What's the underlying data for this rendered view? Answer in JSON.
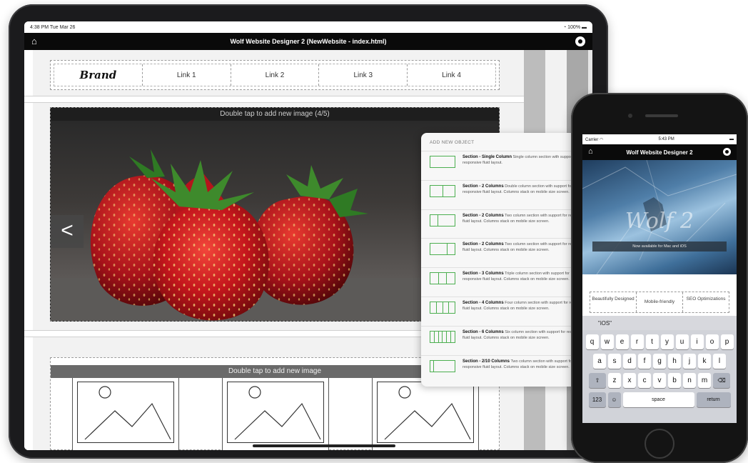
{
  "ipad": {
    "status": {
      "time": "4:38 PM  Tue Mar 26",
      "battery": "100%"
    },
    "nav": {
      "title": "Wolf Website Designer 2 (NewWebsite - index.html)",
      "home_icon": "home-icon",
      "settings_icon": "gear-icon"
    },
    "navbar": {
      "brand": "Brand",
      "links": [
        "Link 1",
        "Link 2",
        "Link 3",
        "Link 4"
      ]
    },
    "carousel": {
      "label": "Double tap to add new image (4/5)",
      "prev": "<"
    },
    "images": {
      "label": "Double tap to add new image"
    },
    "panel": {
      "title": "ADD NEW OBJECT",
      "items": [
        {
          "name": "Section - Single Column",
          "desc": "Single column section with support for responsive fluid layout."
        },
        {
          "name": "Section - 2 Columns",
          "desc": "Double column section with support for responsive fluid layout.  Columns stack on mobile size screen."
        },
        {
          "name": "Section - 2 Columns",
          "desc": "Two column section with support for responsive fluid layout.  Columns stack on mobile size screen."
        },
        {
          "name": "Section - 2 Columns",
          "desc": "Two column section with support for responsive fluid layout.  Columns stack on mobile size screen."
        },
        {
          "name": "Section - 3 Columns",
          "desc": "Triple column section with support for responsive fluid layout.  Columns stack on mobile size screen."
        },
        {
          "name": "Section - 4 Columns",
          "desc": "Four column section with support for responsive fluid layout.  Columns stack on mobile size screen."
        },
        {
          "name": "Section - 6 Columns",
          "desc": "Six column section with support for responsive fluid layout.  Columns stack on mobile size screen."
        },
        {
          "name": "Section - 2/10 Columns",
          "desc": "Two column section with support for responsive fluid layout.  Columns stack on mobile size screen."
        }
      ]
    }
  },
  "iphone": {
    "status": {
      "carrier": "Carrier",
      "time": "5:43 PM"
    },
    "nav": {
      "title": "Wolf Website Designer 2"
    },
    "hero": {
      "logo": "Wolf 2",
      "tagline": "Now available for Mac and iOS"
    },
    "features": [
      "Beautifully Designed",
      "Mobile-friendly",
      "SEO Optimizations"
    ],
    "keyboard": {
      "suggestion": "\"iOS\"",
      "row1": [
        "q",
        "w",
        "e",
        "r",
        "t",
        "y",
        "u",
        "i",
        "o",
        "p"
      ],
      "row2": [
        "a",
        "s",
        "d",
        "f",
        "g",
        "h",
        "j",
        "k",
        "l"
      ],
      "row3": [
        "z",
        "x",
        "c",
        "v",
        "b",
        "n",
        "m"
      ],
      "numbers": "123",
      "space": "space",
      "return": "return"
    }
  },
  "colors": {
    "accent": "#4caf50",
    "nav_bg": "#0a0a0a"
  }
}
